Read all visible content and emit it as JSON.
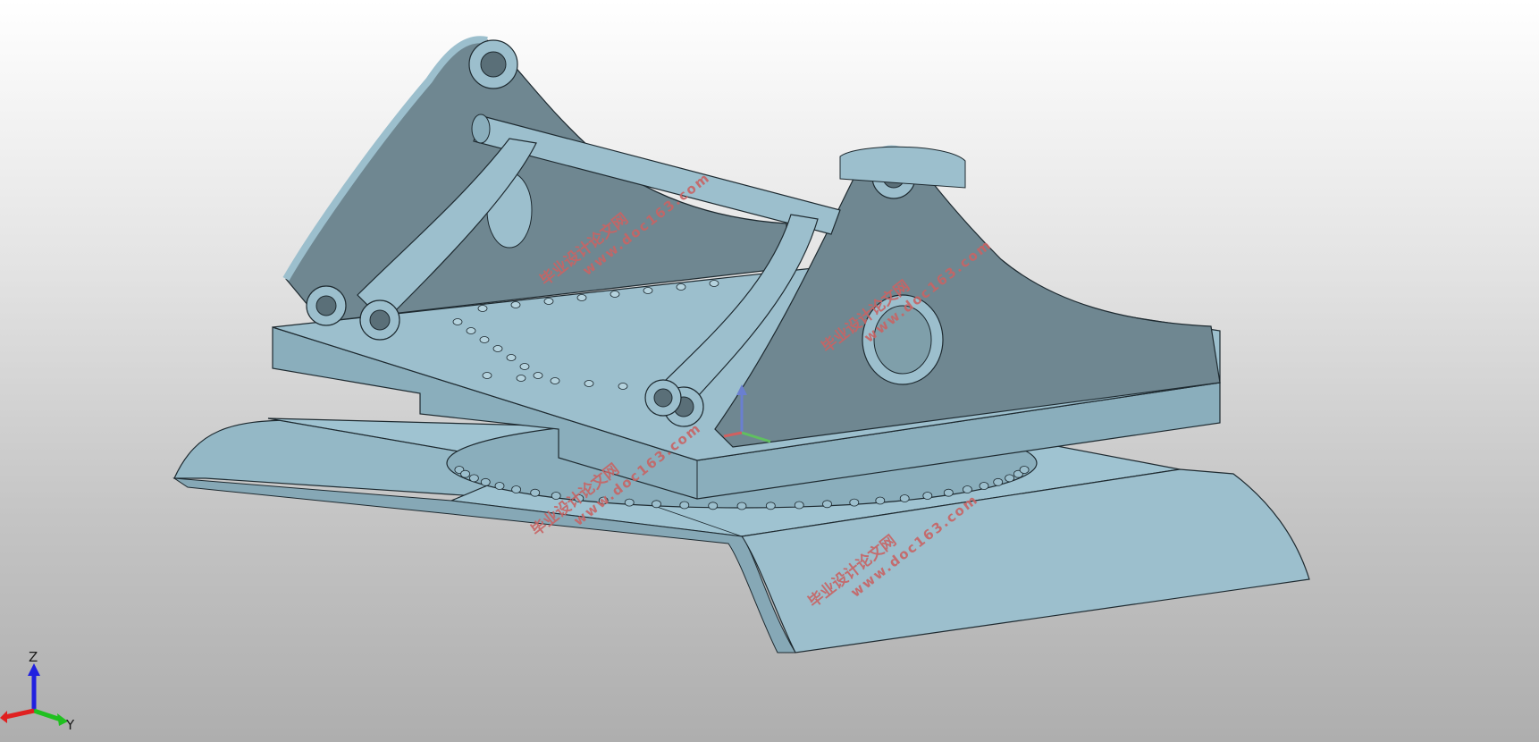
{
  "viewport": {
    "background_top": "#ffffff",
    "background_bottom": "#aeaeae",
    "model_color": "#9cbfcd",
    "model_shadow_color": "#6f8791"
  },
  "watermark": {
    "text": "毕业设计论文网",
    "url": "www.doc163.com",
    "color": "#c86464"
  },
  "triad": {
    "z_label": "Z",
    "y_label": "Y",
    "x_color": "#e02020",
    "y_color": "#20c020",
    "z_color": "#2020e0"
  }
}
